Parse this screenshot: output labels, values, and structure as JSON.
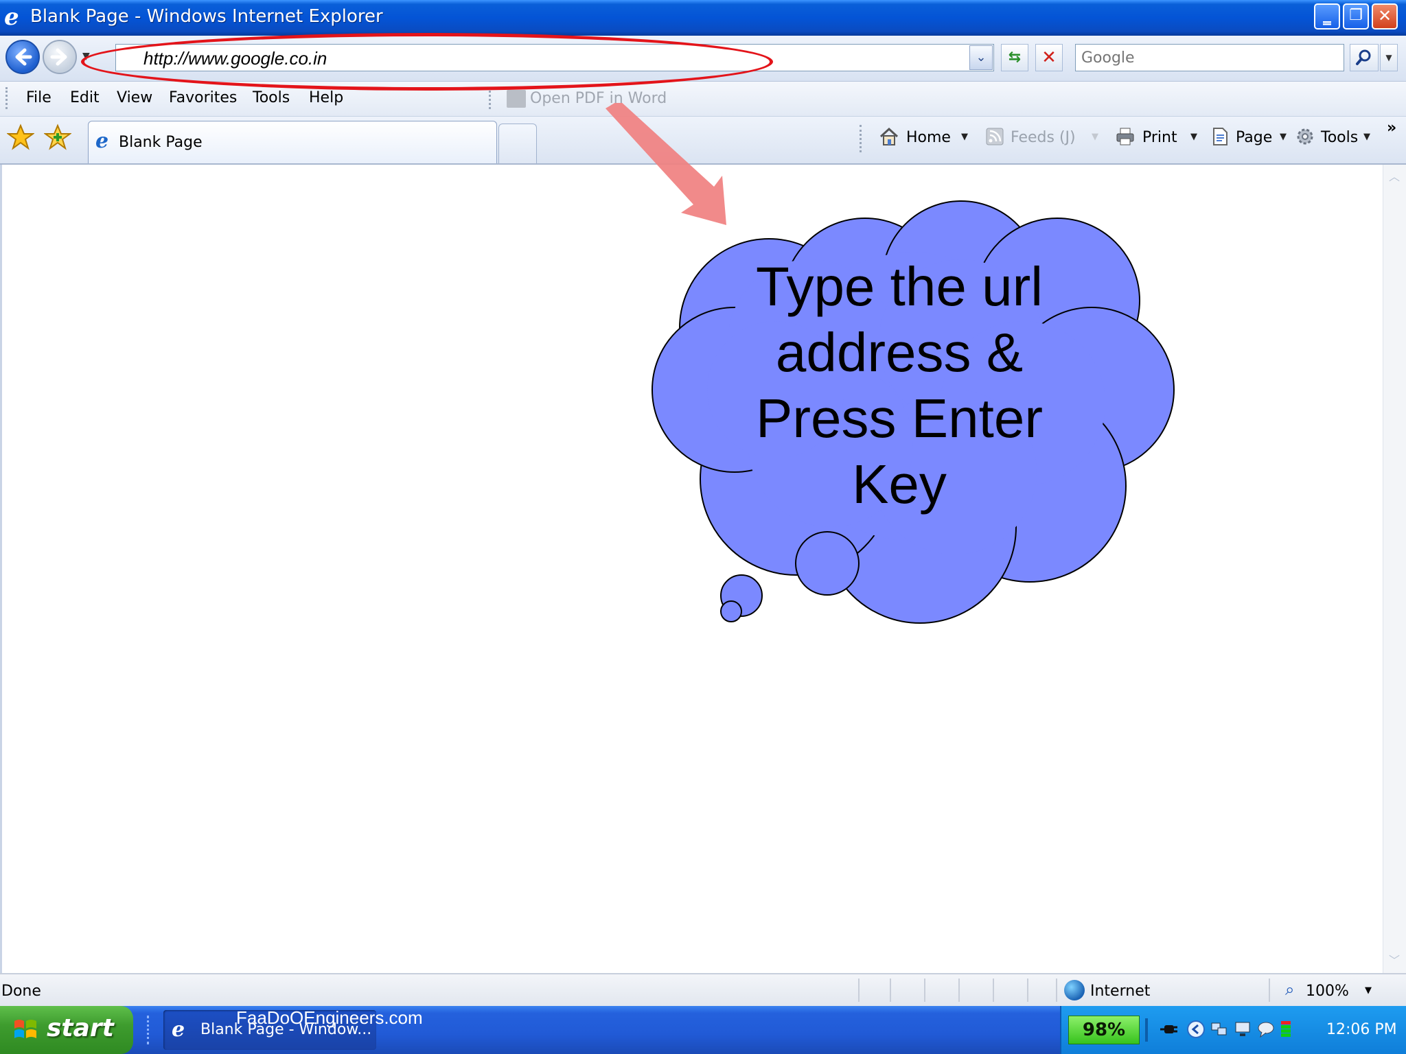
{
  "window": {
    "title": "Blank Page - Windows Internet Explorer",
    "minimize_glyph": "‗",
    "restore_glyph": "❐",
    "close_glyph": "✕"
  },
  "address_bar": {
    "url": "http://www.google.co.in",
    "search_placeholder": "Google"
  },
  "menu": {
    "items": [
      "File",
      "Edit",
      "View",
      "Favorites",
      "Tools",
      "Help"
    ],
    "pdf_label": "Open PDF in Word"
  },
  "tab": {
    "label": "Blank Page"
  },
  "command_bar": {
    "home": "Home",
    "feeds": "Feeds (J)",
    "print": "Print",
    "page": "Page",
    "tools": "Tools"
  },
  "annotation": {
    "lines": [
      "Type the url",
      "address &",
      "Press Enter",
      "Key"
    ],
    "cloud_color": "#7b89ff",
    "ellipse_color": "#e3141a",
    "arrow_color": "#f08080"
  },
  "status_bar": {
    "status": "Done",
    "zone": "Internet",
    "zoom": "100%"
  },
  "taskbar": {
    "start_label": "start",
    "task_label": "Blank Page - Window...",
    "watermark": "FaaDoOEngineers.com",
    "battery": "98%",
    "clock": "12:06 PM"
  },
  "icons": [
    "ie-icon",
    "back-arrow-icon",
    "forward-arrow-icon",
    "refresh-icon",
    "stop-icon",
    "search-icon",
    "star-icon",
    "add-favorite-icon",
    "home-icon",
    "feeds-icon",
    "printer-icon",
    "page-icon",
    "gear-icon",
    "globe-icon",
    "magnifier-icon",
    "windows-logo-icon"
  ]
}
